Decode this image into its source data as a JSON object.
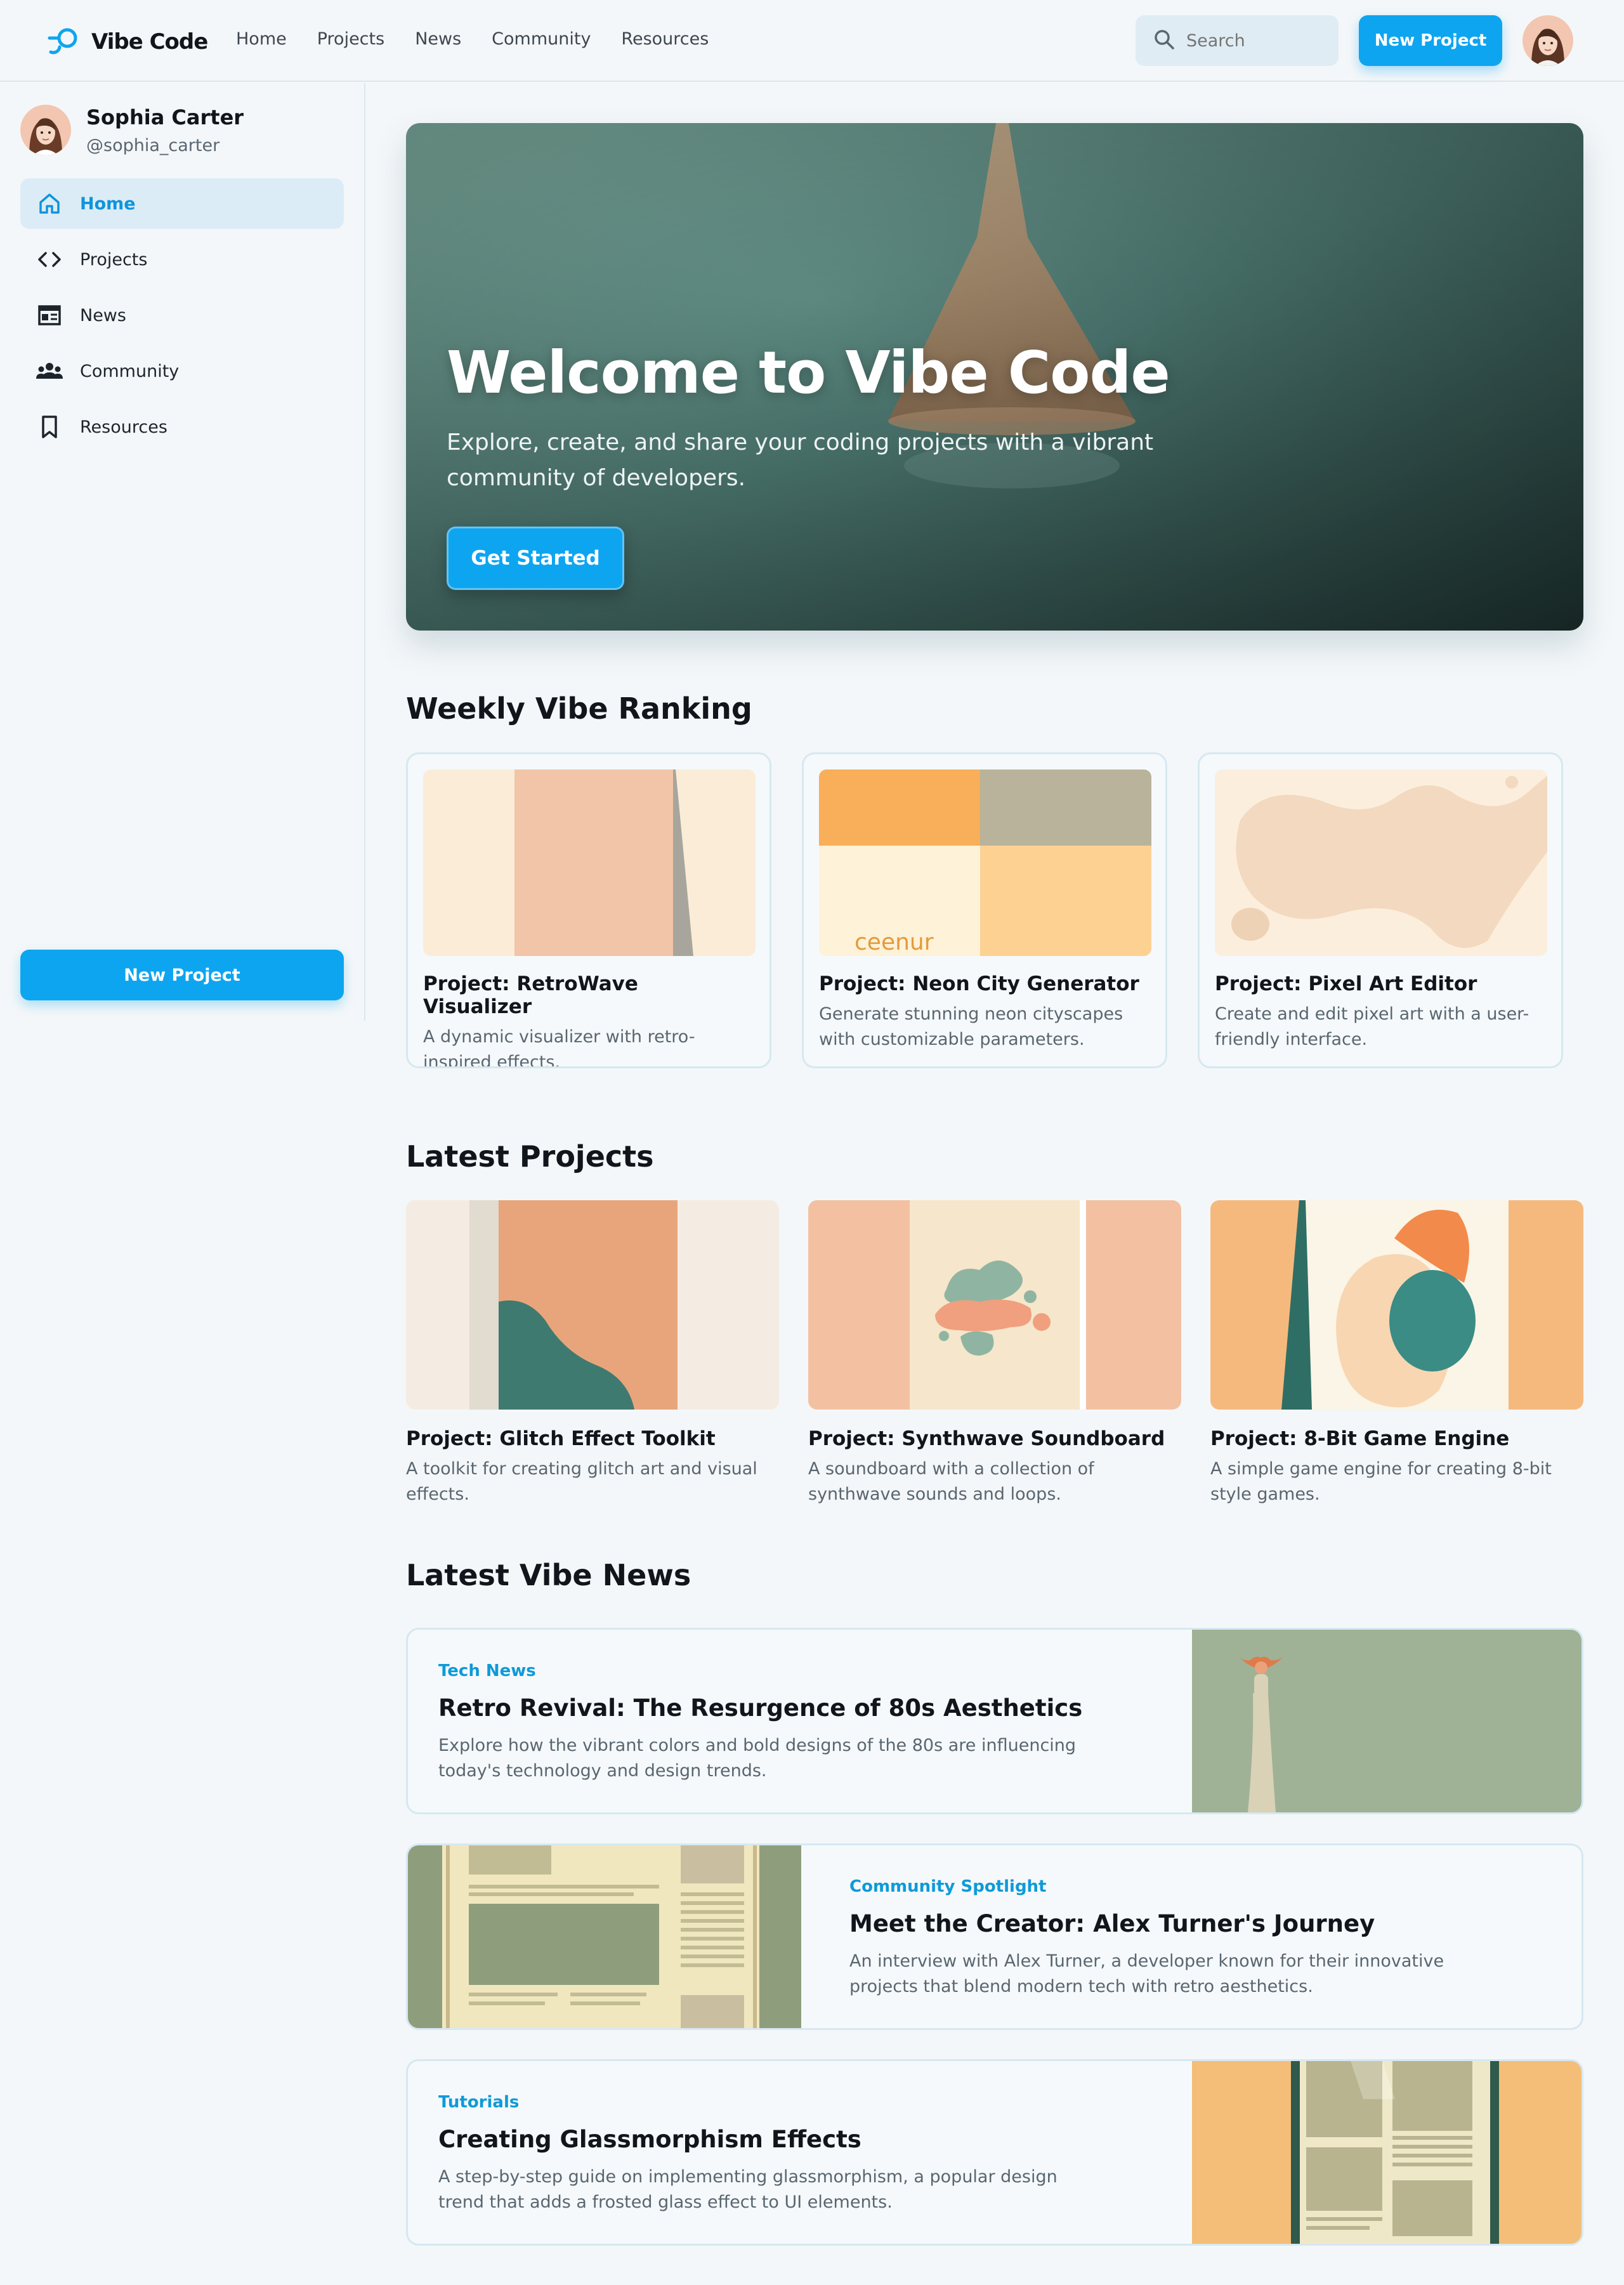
{
  "header": {
    "app_name": "Vibe Code",
    "nav": [
      "Home",
      "Projects",
      "News",
      "Community",
      "Resources"
    ],
    "search_placeholder": "Search",
    "new_project": "New Project"
  },
  "sidebar": {
    "user_name": "Sophia Carter",
    "user_handle": "@sophia_carter",
    "items": [
      {
        "label": "Home",
        "icon": "home-icon",
        "active": true
      },
      {
        "label": "Projects",
        "icon": "code-icon",
        "active": false
      },
      {
        "label": "News",
        "icon": "newspaper-icon",
        "active": false
      },
      {
        "label": "Community",
        "icon": "people-icon",
        "active": false
      },
      {
        "label": "Resources",
        "icon": "bookmark-icon",
        "active": false
      }
    ],
    "new_project": "New Project"
  },
  "hero": {
    "title": "Welcome to Vibe Code",
    "subtitle": "Explore, create, and share your coding projects with a vibrant community of developers.",
    "cta": "Get Started"
  },
  "weekly_ranking": {
    "heading": "Weekly Vibe Ranking",
    "cards": [
      {
        "title": "Project: RetroWave Visualizer",
        "description": "A dynamic visualizer with retro-inspired effects."
      },
      {
        "title": "Project: Neon City Generator",
        "description": "Generate stunning neon cityscapes with customizable parameters.",
        "image_text": "ceenur"
      },
      {
        "title": "Project: Pixel Art Editor",
        "description": "Create and edit pixel art with a user-friendly interface."
      }
    ]
  },
  "latest_projects": {
    "heading": "Latest Projects",
    "cards": [
      {
        "title": "Project: Glitch Effect Toolkit",
        "description": "A toolkit for creating glitch art and visual effects."
      },
      {
        "title": "Project: Synthwave Soundboard",
        "description": "A soundboard with a collection of synthwave sounds and loops."
      },
      {
        "title": "Project: 8-Bit Game Engine",
        "description": "A simple game engine for creating 8-bit style games."
      }
    ]
  },
  "latest_news": {
    "heading": "Latest Vibe News",
    "items": [
      {
        "category": "Tech News",
        "title": "Retro Revival: The Resurgence of 80s Aesthetics",
        "description": "Explore how the vibrant colors and bold designs of the 80s are influencing today's technology and design trends."
      },
      {
        "category": "Community Spotlight",
        "title": "Meet the Creator: Alex Turner's Journey",
        "description": "An interview with Alex Turner, a developer known for their innovative projects that blend modern tech with retro aesthetics."
      },
      {
        "category": "Tutorials",
        "title": "Creating Glassmorphism Effects",
        "description": "A step-by-step guide on implementing glassmorphism, a popular design trend that adds a frosted glass effect to UI elements."
      }
    ]
  },
  "colors": {
    "accent": "#0ea5f0",
    "page_bg": "#f4f7f9",
    "card_border": "#d6e8f2",
    "active_nav_bg": "#dcecf7"
  }
}
